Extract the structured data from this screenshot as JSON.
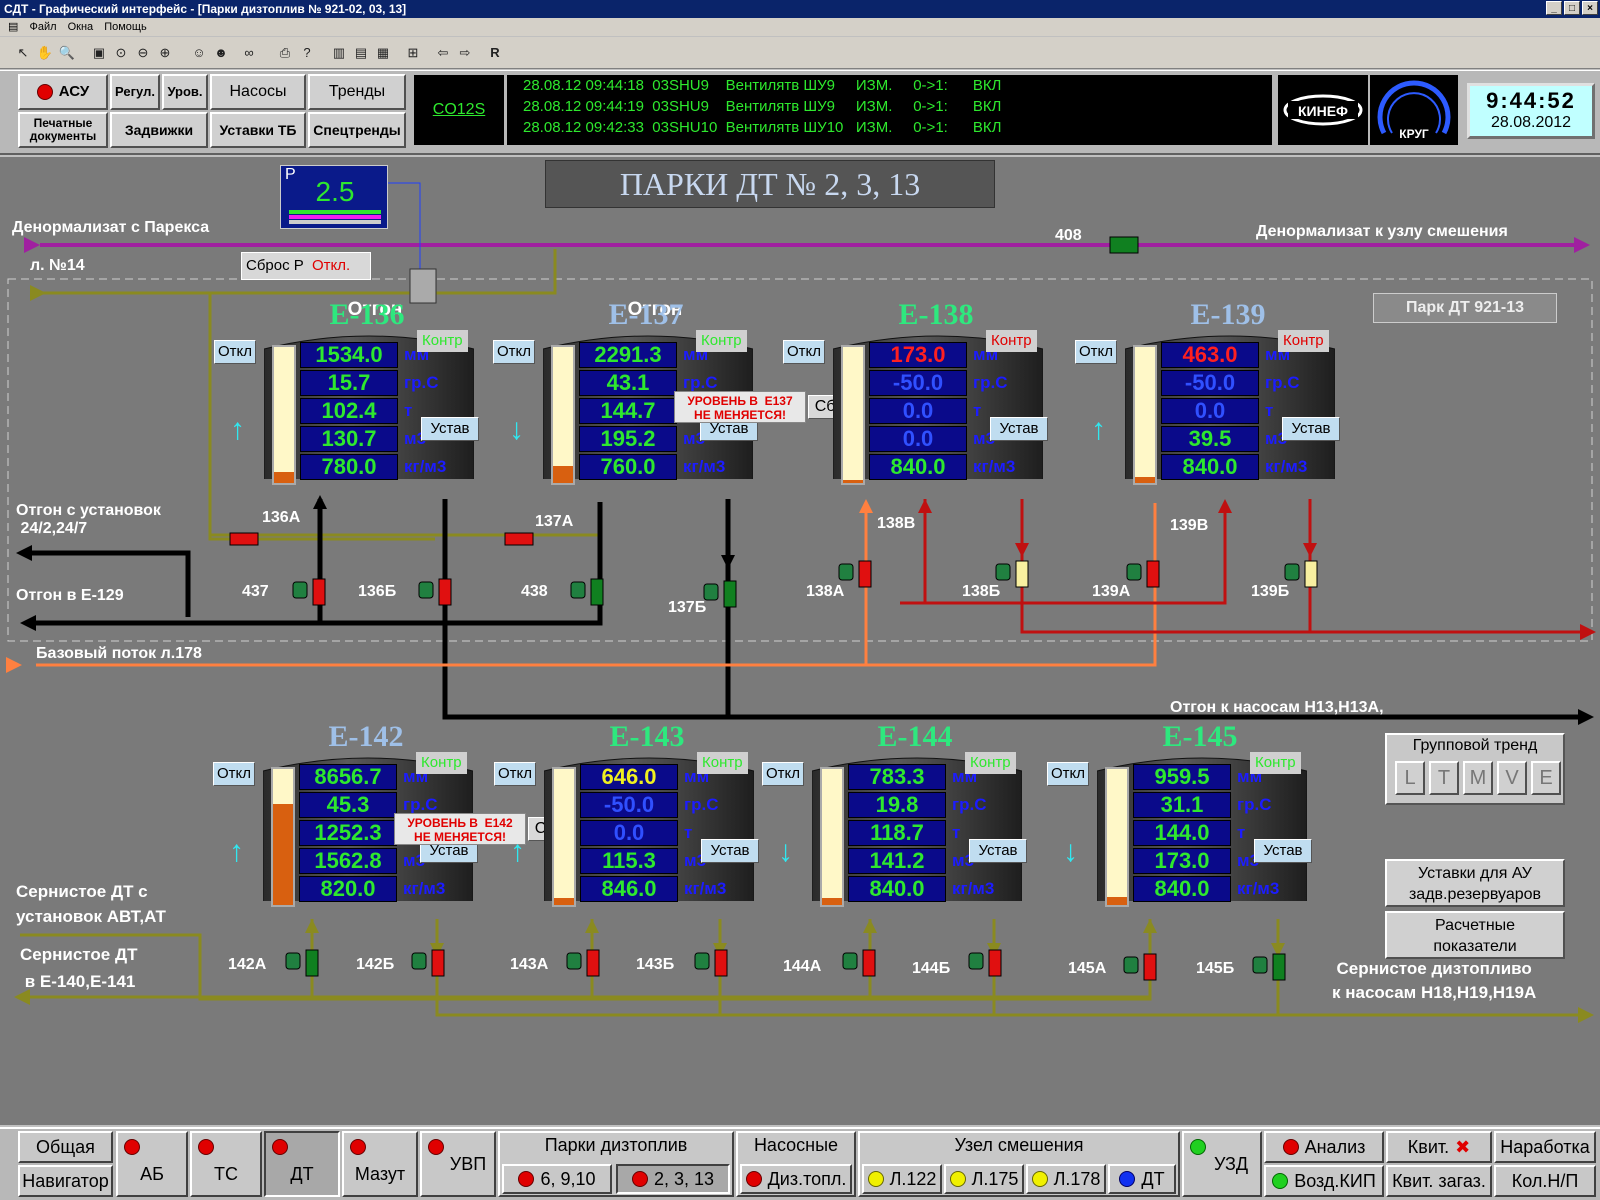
{
  "window": {
    "title": "СДТ - Графический интерфейс - [Парки дизтоплив № 921-02, 03, 13]"
  },
  "menu": [
    "Файл",
    "Окна",
    "Помощь"
  ],
  "header": {
    "nav_buttons": [
      {
        "id": "asu",
        "label": "АСУ"
      },
      {
        "id": "regul",
        "label": "Регул."
      },
      {
        "id": "urov",
        "label": "Уров."
      },
      {
        "id": "nasosy",
        "label": "Насосы"
      },
      {
        "id": "trendy",
        "label": "Тренды"
      },
      {
        "id": "pechat",
        "label": "Печатные документы"
      },
      {
        "id": "zadvizhki",
        "label": "Задвижки"
      },
      {
        "id": "ustavki_tb",
        "label": "Уставки ТБ"
      },
      {
        "id": "spectrendy",
        "label": "Спецтренды"
      }
    ],
    "station": "CO12S",
    "events": [
      "28.08.12 09:44:18  03SHU9    Вентилятв ШУ9     ИЗМ.     0->1:      ВКЛ",
      "28.08.12 09:44:19  03SHU9    Вентилятв ШУ9     ИЗМ.     0->1:      ВКЛ",
      "28.08.12 09:42:33  03SHU10  Вентилятв ШУ10   ИЗМ.     0->1:      ВКЛ"
    ],
    "logo1": "КИНЕФ",
    "logo2": "КРУГ",
    "clock": {
      "time": "9:44:52",
      "date": "28.08.2012"
    }
  },
  "scheme": {
    "title": "ПАРКИ ДТ № 2, 3, 13",
    "park_label": "Парк ДТ 921-13",
    "pressure": {
      "label": "P",
      "value": "2.5",
      "reset": "Сброс Р",
      "reset_state": "Откл."
    },
    "pipe_labels": {
      "denorm_in": "Денормализат с Парекса",
      "denorm_out": "Денормализат к узлу смешения",
      "line14": "л. №14",
      "v408": "408",
      "otgon_in": "Отгон с установок\n 24/2,24/7",
      "otgon_e129": "Отгон в Е-129",
      "base_flow": "Базовый поток л.178",
      "otgon_pumps": "Отгон к насосам Н13,Н13А,",
      "sern_in": "Сернистое ДТ с\nустановок АВТ,АТ",
      "sern_e140": "Сернистое ДТ\n в Е-140,Е-141",
      "sern_out": "Сернистое дизтопливо\nк насосам Н18,Н19,Н19А"
    },
    "otgon_labels": [
      "Отгон",
      "Отгон"
    ],
    "valves": [
      "136А",
      "437",
      "136Б",
      "137А",
      "438",
      "137Б",
      "138В",
      "138А",
      "138Б",
      "139В",
      "139А",
      "139Б",
      "142А",
      "142Б",
      "143А",
      "143Б",
      "144А",
      "144Б",
      "145А",
      "145Б"
    ],
    "units": [
      "мм",
      "гр.С",
      "т",
      "м3",
      "кг/м3"
    ],
    "otkl_label": "Откл",
    "ustav_label": "Устав",
    "kontr_label": "Контр",
    "tanks": [
      {
        "name": "Е-136",
        "vals": [
          "1534.0",
          "15.7",
          "102.4",
          "130.7",
          "780.0"
        ],
        "level": 0.08
      },
      {
        "name": "Е-137",
        "vals": [
          "2291.3",
          "43.1",
          "144.7",
          "195.2",
          "760.0"
        ],
        "level": 0.12,
        "warning": "УРОВЕНЬ В  Е137\nНЕ МЕНЯЕТСЯ!",
        "reset": "Сброс"
      },
      {
        "name": "Е-138",
        "vals": [
          "173.0",
          "-50.0",
          "0.0",
          "0.0",
          "840.0"
        ],
        "level": 0.02
      },
      {
        "name": "Е-139",
        "vals": [
          "463.0",
          "-50.0",
          "0.0",
          "39.5",
          "840.0"
        ],
        "level": 0.04
      },
      {
        "name": "Е-142",
        "vals": [
          "8656.7",
          "45.3",
          "1252.3",
          "1562.8",
          "820.0"
        ],
        "level": 0.72,
        "warning": "УРОВЕНЬ В  Е142\nНЕ МЕНЯЕТСЯ!",
        "reset": "Сброс"
      },
      {
        "name": "Е-143",
        "vals": [
          "646.0",
          "-50.0",
          "0.0",
          "115.3",
          "846.0"
        ],
        "level": 0.05
      },
      {
        "name": "Е-144",
        "vals": [
          "783.3",
          "19.8",
          "118.7",
          "141.2",
          "840.0"
        ],
        "level": 0.05
      },
      {
        "name": "Е-145",
        "vals": [
          "959.5",
          "31.1",
          "144.0",
          "173.0",
          "840.0"
        ],
        "level": 0.06
      }
    ],
    "group_trend": {
      "title": "Групповой тренд",
      "buttons": [
        "L",
        "T",
        "M",
        "V",
        "E"
      ]
    },
    "side_buttons": [
      "Уставки для АУ\nзадв.резервуаров",
      "Расчетные\nпоказатели"
    ]
  },
  "footer": {
    "obshaya": "Общая",
    "navigator": "Навигатор",
    "ab": "АБ",
    "ts": "ТС",
    "dt": "ДТ",
    "mazut": "Мазут",
    "uvp": "УВП",
    "parki": "Парки дизтоплив",
    "p1": "6, 9,10",
    "p2": "2, 3, 13",
    "nasosnye": "Насосные",
    "diztopl": "Диз.топл.",
    "uzel": "Узел смешения",
    "l122": "Л.122",
    "l175": "Л.175",
    "l178": "Л.178",
    "dt2": "ДТ",
    "uzd": "УЗД",
    "analiz": "Анализ",
    "vozd": "Возд.КИП",
    "kvit": "Квит.",
    "kvit_zagaz": "Квит. загаз.",
    "narabotka": "Наработка",
    "kol": "Кол.Н/П"
  }
}
